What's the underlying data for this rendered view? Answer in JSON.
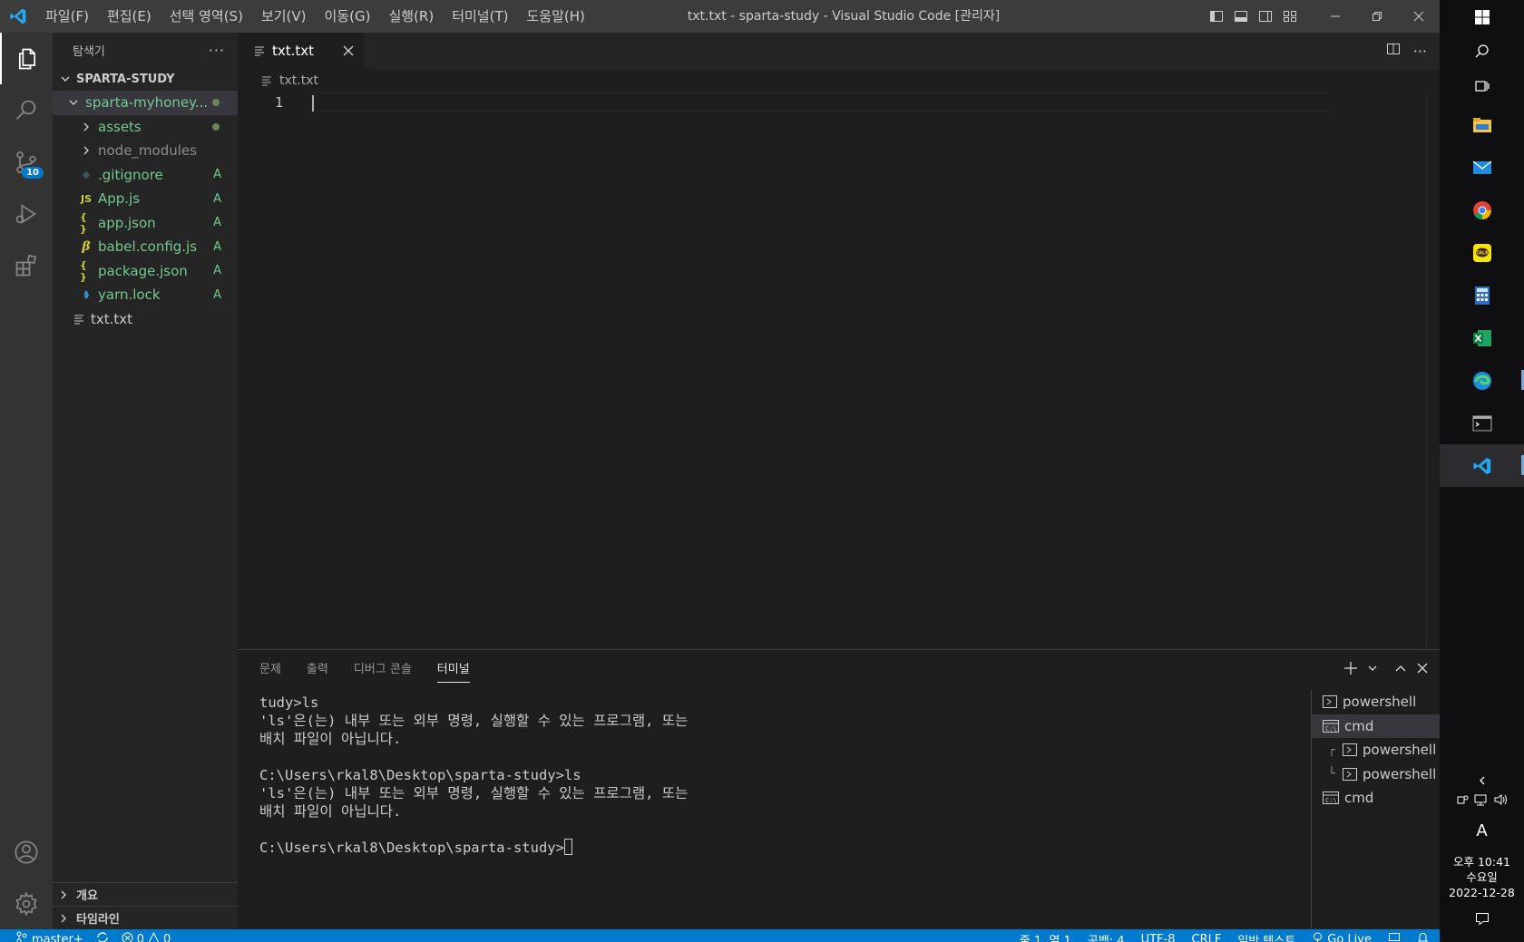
{
  "titlebar": {
    "menu": [
      "파일(F)",
      "편집(E)",
      "선택 영역(S)",
      "보기(V)",
      "이동(G)",
      "실행(R)",
      "터미널(T)",
      "도움말(H)"
    ],
    "title": "txt.txt - sparta-study - Visual Studio Code [관리자]"
  },
  "activitybar": {
    "scm_badge": "10"
  },
  "sidebar": {
    "title": "탐색기",
    "section": "SPARTA-STUDY",
    "items": [
      {
        "label": "sparta-myhoney...",
        "status": ""
      },
      {
        "label": "assets",
        "status": ""
      },
      {
        "label": "node_modules",
        "status": ""
      },
      {
        "label": ".gitignore",
        "status": "A"
      },
      {
        "label": "App.js",
        "status": "A",
        "icon": "JS"
      },
      {
        "label": "app.json",
        "status": "A",
        "icon": "{ }"
      },
      {
        "label": "babel.config.js",
        "status": "A"
      },
      {
        "label": "package.json",
        "status": "A",
        "icon": "{ }"
      },
      {
        "label": "yarn.lock",
        "status": "A"
      },
      {
        "label": "txt.txt",
        "status": ""
      }
    ],
    "footer": [
      "개요",
      "타임라인"
    ]
  },
  "editor": {
    "tab": "txt.txt",
    "breadcrumb": "txt.txt",
    "line_number": "1"
  },
  "panel": {
    "tabs": [
      "문제",
      "출력",
      "디버그 콘솔",
      "터미널"
    ],
    "terminal_lines": [
      "tudy>ls",
      "'ls'은(는) 내부 또는 외부 명령, 실행할 수 있는 프로그램, 또는",
      "배치 파일이 아닙니다.",
      "",
      "C:\\Users\\rkal8\\Desktop\\sparta-study>ls",
      "'ls'은(는) 내부 또는 외부 명령, 실행할 수 있는 프로그램, 또는",
      "배치 파일이 아닙니다.",
      "",
      "C:\\Users\\rkal8\\Desktop\\sparta-study>"
    ],
    "terminals": [
      {
        "label": "powershell",
        "kind": "powershell",
        "tree": ""
      },
      {
        "label": "cmd",
        "kind": "cmd",
        "tree": ""
      },
      {
        "label": "powershell",
        "kind": "powershell",
        "tree": "┌"
      },
      {
        "label": "powershell",
        "kind": "powershell",
        "tree": "└"
      },
      {
        "label": "cmd",
        "kind": "cmd",
        "tree": ""
      }
    ]
  },
  "statusbar": {
    "branch": "master+",
    "errors": "0",
    "warnings": "0",
    "position": "줄 1, 열 1",
    "spaces": "공백: 4",
    "encoding": "UTF-8",
    "eol": "CRLF",
    "language": "일반 텍스트",
    "golive": "Go Live"
  },
  "taskbar": {
    "ime": "A",
    "time": "오후 10:41",
    "day": "수요일",
    "date": "2022-12-28"
  },
  "colors": {
    "accent": "#007acc",
    "git_added": "#73c991"
  }
}
